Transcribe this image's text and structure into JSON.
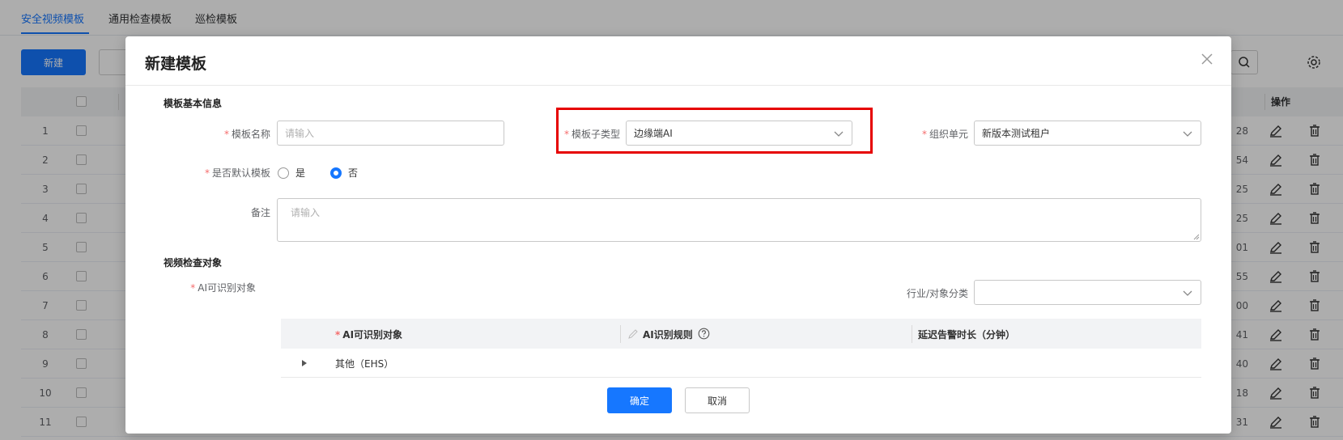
{
  "background": {
    "tabs": [
      "安全视频模板",
      "通用检查模板",
      "巡检模板"
    ],
    "new_button": "新建",
    "ops_header": "操作",
    "rows": [
      {
        "no": "1",
        "tail": "28"
      },
      {
        "no": "2",
        "tail": "54"
      },
      {
        "no": "3",
        "tail": "25"
      },
      {
        "no": "4",
        "tail": "25"
      },
      {
        "no": "5",
        "tail": "01"
      },
      {
        "no": "6",
        "tail": "55"
      },
      {
        "no": "7",
        "tail": "00"
      },
      {
        "no": "8",
        "tail": "41"
      },
      {
        "no": "9",
        "tail": "40"
      },
      {
        "no": "10",
        "tail": "18"
      },
      {
        "no": "11",
        "tail": "31"
      }
    ]
  },
  "modal": {
    "title": "新建模板",
    "section_basic": "模板基本信息",
    "template_name": {
      "label": "模板名称",
      "placeholder": "请输入",
      "value": ""
    },
    "template_subtype": {
      "label": "模板子类型",
      "value": "边缘端AI"
    },
    "org_unit": {
      "label": "组织单元",
      "value": "新版本测试租户"
    },
    "is_default": {
      "label": "是否默认模板",
      "options": [
        "是",
        "否"
      ],
      "selected": "否"
    },
    "remark": {
      "label": "备注",
      "placeholder": "请输入"
    },
    "section_video": "视频检查对象",
    "ai_objects_label": "AI可识别对象",
    "industry": {
      "label": "行业/对象分类",
      "value": ""
    },
    "table": {
      "columns": [
        "AI可识别对象",
        "AI识别规则",
        "延迟告警时长（分钟）"
      ],
      "rows": [
        {
          "label": "其他（EHS）"
        }
      ]
    },
    "confirm_button": "确定",
    "cancel_button": "取消"
  },
  "colors": {
    "primary": "#1677ff",
    "required": "#f56c6c",
    "highlight": "#e60000"
  }
}
